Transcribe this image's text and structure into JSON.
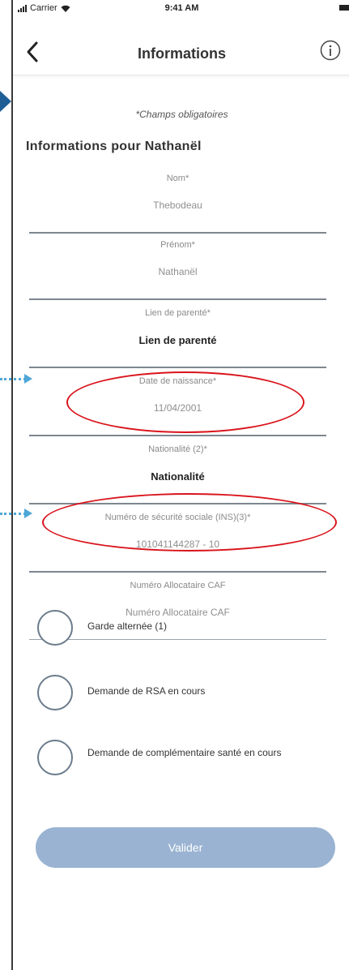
{
  "statusbar": {
    "carrier": "Carrier",
    "time": "9:41 AM"
  },
  "navbar": {
    "title": "Informations"
  },
  "form": {
    "required_note": "*Champs obligatoires",
    "section_title": "Informations pour Nathanël",
    "fields": [
      {
        "label": "Nom*",
        "value": "Thebodeau"
      },
      {
        "label": "Prénom*",
        "value": "Nathanël"
      },
      {
        "label": "Lien de parenté*",
        "value": "Lien de parenté"
      },
      {
        "label": "Date de naissance*",
        "value": "11/04/2001"
      },
      {
        "label": "Nationalité (2)*",
        "value": "Nationalité"
      },
      {
        "label": "Numéro de sécurité sociale (INS)(3)*",
        "value": "101041144287 - 10"
      },
      {
        "label": "Numéro Allocataire CAF",
        "value": "Numéro Allocataire CAF"
      }
    ]
  },
  "options": [
    {
      "label": "Garde alternée (1)"
    },
    {
      "label": "Demande de RSA en cours"
    },
    {
      "label": "Demande de complémentaire santé en cours"
    }
  ],
  "submit": {
    "label": "Valider"
  },
  "colors": {
    "annotation_red": "#d9141c",
    "annotation_blue": "#4fa7d7",
    "marker_blue": "#1f5f96",
    "button_bg": "#9ab3d2"
  }
}
